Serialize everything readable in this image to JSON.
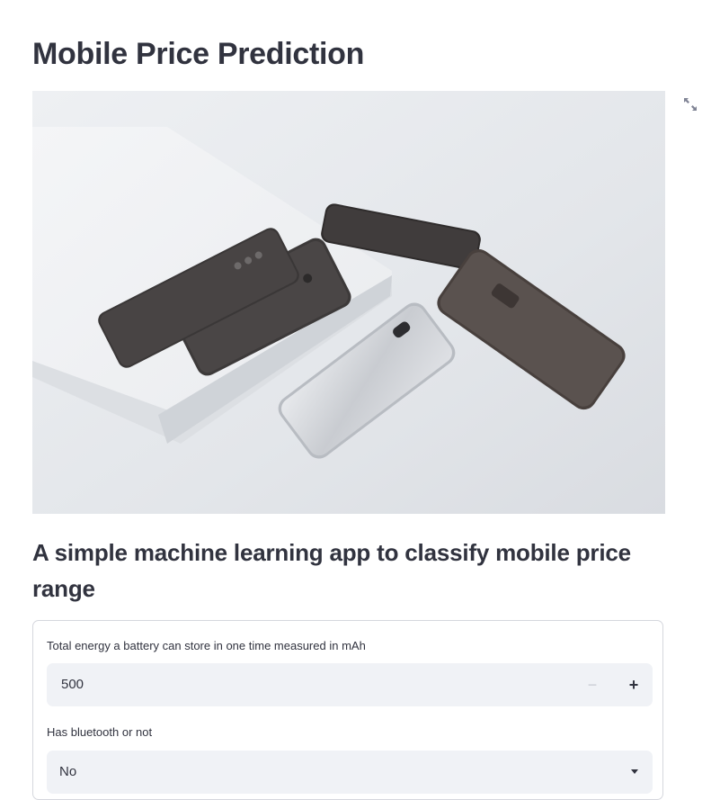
{
  "page": {
    "title": "Mobile Price Prediction",
    "subtitle": "A simple machine learning app to classify mobile price range"
  },
  "hero_image": {
    "description_icon": "image",
    "fullscreen_icon": "expand-icon"
  },
  "form": {
    "battery": {
      "label": "Total energy a battery can store in one time measured in mAh",
      "value": "500",
      "minus_symbol": "−",
      "plus_symbol": "+"
    },
    "bluetooth": {
      "label": "Has bluetooth or not",
      "value": "No"
    }
  },
  "colors": {
    "text": "#31333f",
    "input_bg": "#f0f2f6",
    "border": "#d5d7dd"
  }
}
